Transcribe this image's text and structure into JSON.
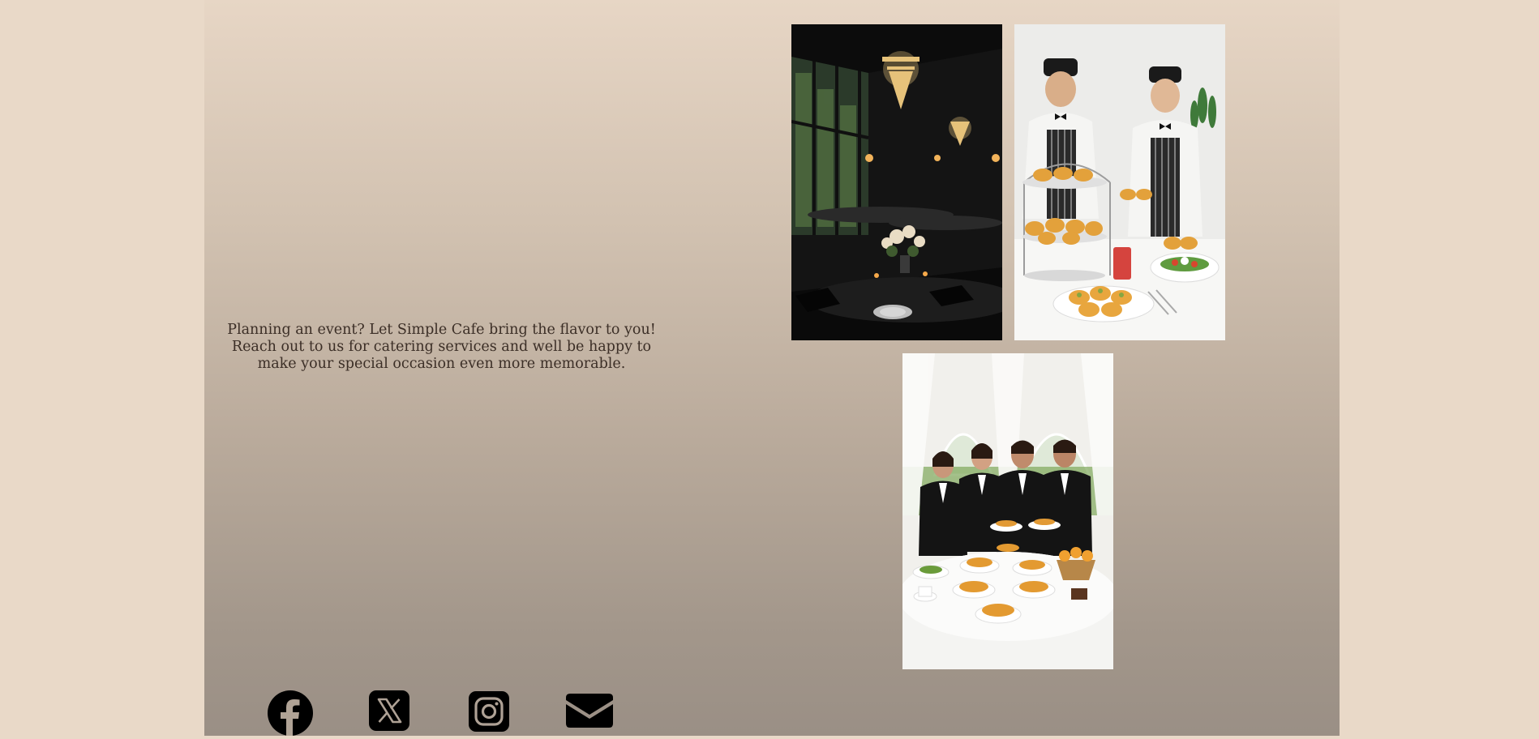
{
  "catering": {
    "message": "Planning an event? Let Simple Cafe bring the flavor to you! Reach out to us for catering services and well be happy to make your special occasion even more memorable."
  },
  "gallery": {
    "images": [
      {
        "name": "catering-dining-room-photo"
      },
      {
        "name": "catering-chefs-photo"
      },
      {
        "name": "catering-team-photo"
      }
    ]
  },
  "social_links": [
    {
      "name": "facebook",
      "icon": "facebook-icon"
    },
    {
      "name": "x",
      "icon": "x-icon"
    },
    {
      "name": "instagram",
      "icon": "instagram-icon"
    },
    {
      "name": "email",
      "icon": "envelope-icon"
    }
  ],
  "colors": {
    "page_background": "#e9d9c8",
    "panel_top": "#e7d6c5",
    "panel_bottom": "#9a8f85",
    "text": "#3b2e26",
    "icon": "#000000"
  }
}
